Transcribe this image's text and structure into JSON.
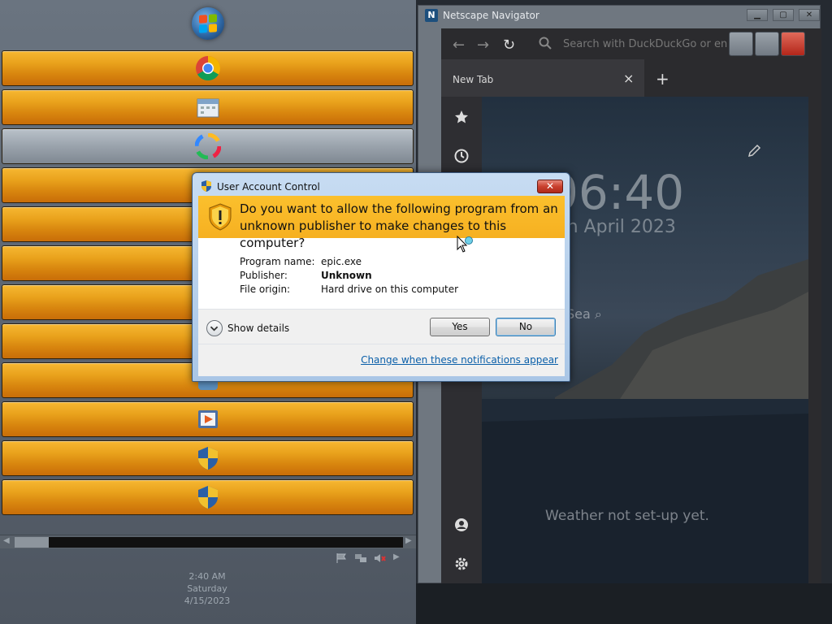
{
  "taskbar": {
    "start_label": "Start",
    "buttons": [
      {
        "icon": "chrome-icon",
        "style": "orange"
      },
      {
        "icon": "calendar-icon",
        "style": "orange"
      },
      {
        "icon": "color-wheel-icon",
        "style": "plain"
      },
      {
        "icon": "blank",
        "style": "orange"
      },
      {
        "icon": "blank",
        "style": "orange"
      },
      {
        "icon": "blank",
        "style": "orange"
      },
      {
        "icon": "blank",
        "style": "orange"
      },
      {
        "icon": "blank",
        "style": "orange"
      },
      {
        "icon": "app-icon",
        "style": "orange"
      },
      {
        "icon": "media-player-icon",
        "style": "orange"
      },
      {
        "icon": "uac-shield-icon",
        "style": "orange"
      },
      {
        "icon": "uac-shield-icon",
        "style": "orange"
      }
    ],
    "clock": {
      "time": "2:40 AM",
      "day": "Saturday",
      "date": "4/15/2023"
    }
  },
  "netscape": {
    "title": "Netscape Navigator",
    "logo_letter": "N",
    "address_placeholder": "Search with DuckDuckGo or en",
    "tab_label": "New Tab",
    "new_tab": "+",
    "tab_close": "×",
    "clock_text": "06:40",
    "date_text": "th April 2023",
    "search_text": "Sea",
    "weather_text": "Weather not set-up yet."
  },
  "uac": {
    "title": "User Account Control",
    "question": "Do you want to allow the following program from an unknown publisher to make changes to this computer?",
    "info": [
      {
        "key": "Program name:",
        "value": "epic.exe",
        "bold": false
      },
      {
        "key": "Publisher:",
        "value": "Unknown",
        "bold": true
      },
      {
        "key": "File origin:",
        "value": "Hard drive on this computer",
        "bold": false
      }
    ],
    "show_details": "Show details",
    "yes_label": "Yes",
    "no_label": "No",
    "change_link": "Change when these notifications appear",
    "close_glyph": "✕"
  },
  "colors": {
    "banner": "#f6b021",
    "taskbar_button": "#e9a21c",
    "link": "#0a5fa9"
  }
}
